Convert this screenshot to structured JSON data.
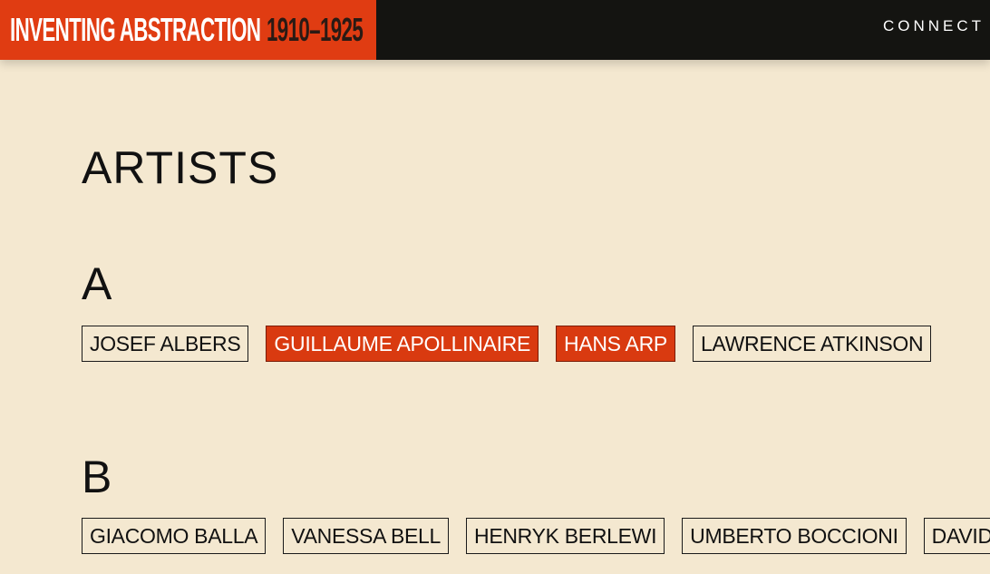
{
  "header": {
    "logo_title": "INVENTING ABSTRACTION",
    "logo_years": "1910–1925",
    "nav_connect": "CONNECT"
  },
  "page": {
    "title": "ARTISTS"
  },
  "sections": [
    {
      "letter": "A",
      "artists": [
        {
          "name": "JOSEF ALBERS",
          "highlighted": false
        },
        {
          "name": "GUILLAUME APOLLINAIRE",
          "highlighted": true
        },
        {
          "name": "HANS ARP",
          "highlighted": true
        },
        {
          "name": "LAWRENCE ATKINSON",
          "highlighted": false
        }
      ]
    },
    {
      "letter": "B",
      "artists": [
        {
          "name": "GIACOMO BALLA",
          "highlighted": false
        },
        {
          "name": "VANESSA BELL",
          "highlighted": false
        },
        {
          "name": "HENRYK BERLEWI",
          "highlighted": false
        },
        {
          "name": "UMBERTO BOCCIONI",
          "highlighted": false
        },
        {
          "name": "DAVID",
          "highlighted": false
        }
      ]
    }
  ],
  "colors": {
    "background": "#f4e8d0",
    "accent": "#e03c12",
    "topbar": "#141411",
    "highlight_chip": "#d93a10"
  }
}
